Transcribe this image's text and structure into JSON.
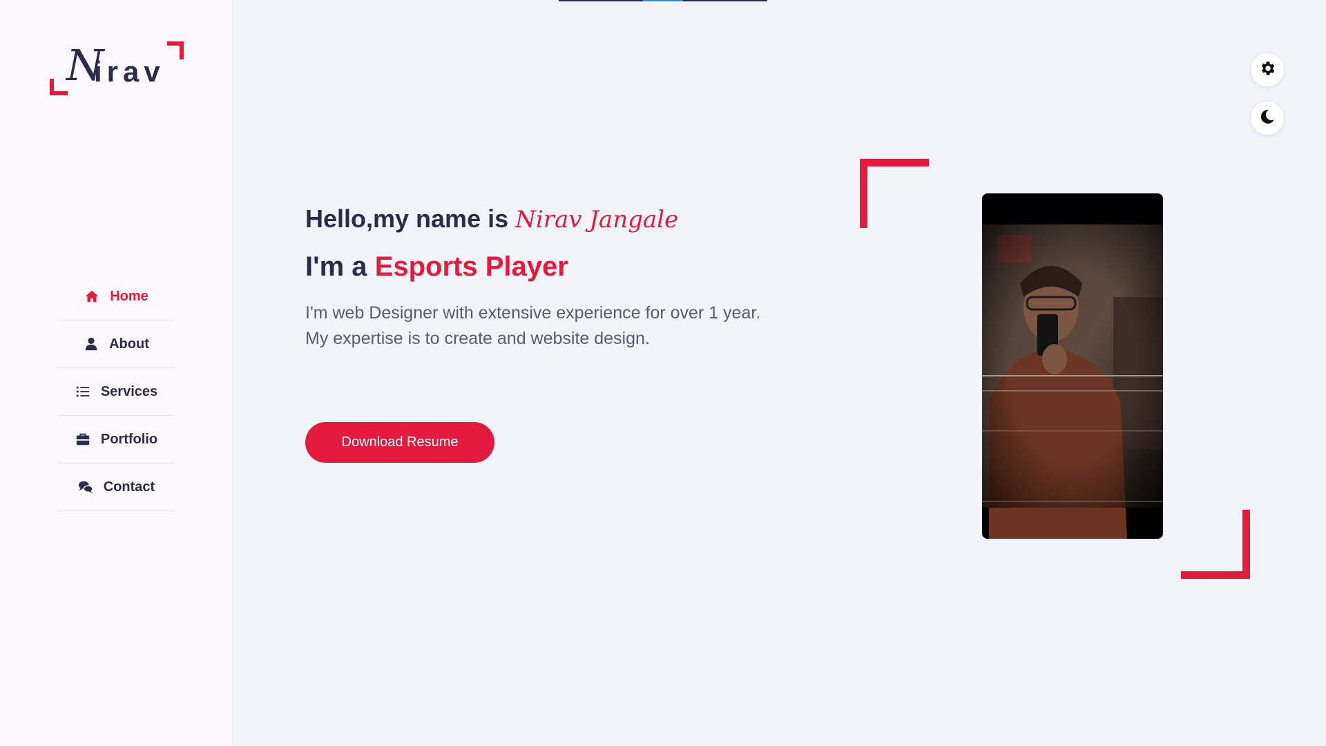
{
  "brand": {
    "logo_first": "N",
    "logo_rest": "irav",
    "accent_color": "#e31a3c",
    "text_color": "#2b2c4a"
  },
  "nav": {
    "items": [
      {
        "label": "Home",
        "icon": "home-icon",
        "active": true
      },
      {
        "label": "About",
        "icon": "user-icon",
        "active": false
      },
      {
        "label": "Services",
        "icon": "list-icon",
        "active": false
      },
      {
        "label": "Portfolio",
        "icon": "briefcase-icon",
        "active": false
      },
      {
        "label": "Contact",
        "icon": "comments-icon",
        "active": false
      }
    ]
  },
  "controls": {
    "settings_icon": "gear-icon",
    "theme_icon": "moon-icon"
  },
  "hero": {
    "greeting": "Hello,my name is",
    "name": "Nirav Jangale",
    "role_prefix": "I'm a",
    "role": "Esports Player",
    "description_line1": "I'm web Designer with extensive experience for over 1 year.",
    "description_line2": "My expertise is to create and website design.",
    "button_label": "Download Resume"
  }
}
